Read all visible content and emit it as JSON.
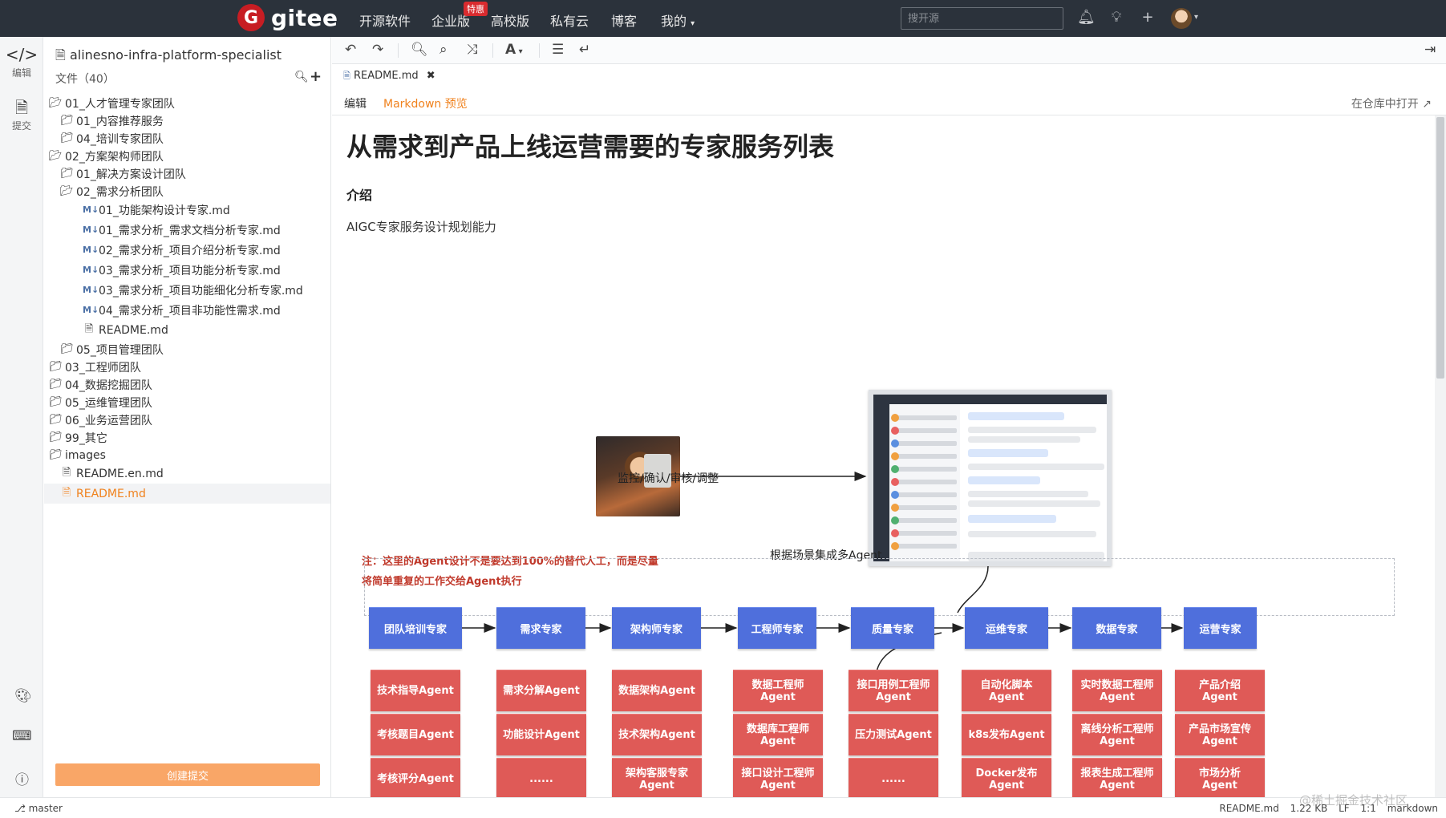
{
  "topnav": {
    "brand": "gitee",
    "links": [
      "开源软件",
      "企业版",
      "高校版",
      "私有云",
      "博客",
      "我的"
    ],
    "hot_badge": "特惠",
    "search_placeholder": "搜开源"
  },
  "activity": {
    "edit_label": "编辑",
    "commit_label": "提交"
  },
  "filetree": {
    "repo_name": "alinesno-infra-platform-specialist",
    "files_count": "文件（40）",
    "nodes": [
      {
        "label": "01_人才管理专家团队",
        "type": "folder-open",
        "depth": 0
      },
      {
        "label": "01_内容推荐服务",
        "type": "folder",
        "depth": 1
      },
      {
        "label": "04_培训专家团队",
        "type": "folder",
        "depth": 1
      },
      {
        "label": "02_方案架构师团队",
        "type": "folder-open",
        "depth": 0
      },
      {
        "label": "01_解决方案设计团队",
        "type": "folder",
        "depth": 1
      },
      {
        "label": "02_需求分析团队",
        "type": "folder-open",
        "depth": 1
      },
      {
        "label": "01_功能架构设计专家.md",
        "type": "md",
        "depth": 2
      },
      {
        "label": "01_需求分析_需求文档分析专家.md",
        "type": "md",
        "depth": 2
      },
      {
        "label": "02_需求分析_项目介绍分析专家.md",
        "type": "md",
        "depth": 2
      },
      {
        "label": "03_需求分析_项目功能分析专家.md",
        "type": "md",
        "depth": 2
      },
      {
        "label": "03_需求分析_项目功能细化分析专家.md",
        "type": "md",
        "depth": 2
      },
      {
        "label": "04_需求分析_项目非功能性需求.md",
        "type": "md",
        "depth": 2
      },
      {
        "label": "README.md",
        "type": "readme",
        "depth": 2
      },
      {
        "label": "05_项目管理团队",
        "type": "folder",
        "depth": 1
      },
      {
        "label": "03_工程师团队",
        "type": "folder",
        "depth": 0
      },
      {
        "label": "04_数据挖掘团队",
        "type": "folder",
        "depth": 0
      },
      {
        "label": "05_运维管理团队",
        "type": "folder",
        "depth": 0
      },
      {
        "label": "06_业务运营团队",
        "type": "folder",
        "depth": 0
      },
      {
        "label": "99_其它",
        "type": "folder",
        "depth": 0
      },
      {
        "label": "images",
        "type": "folder",
        "depth": 0
      },
      {
        "label": "README.en.md",
        "type": "readme",
        "depth": 0
      },
      {
        "label": "README.md",
        "type": "readme",
        "depth": 0,
        "active": true
      }
    ],
    "commit_button": "创建提交"
  },
  "editor": {
    "file_tab": "README.md",
    "mode_edit": "编辑",
    "mode_preview": "Markdown 预览",
    "open_in_repo": "在仓库中打开"
  },
  "preview": {
    "h1": "从需求到产品上线运营需要的专家服务列表",
    "h2": "介绍",
    "para": "AIGC专家服务设计规划能力",
    "diagram": {
      "arrow_label": "监控/确认/审核/调整",
      "integrate_label": "根据场景集成多Agent",
      "note_line1": "注：这里的Agent设计不是要达到100%的替代人工，而是尽量",
      "note_line2": "将简单重复的工作交给Agent执行",
      "roles": [
        "团队培训专家",
        "需求专家",
        "架构师专家",
        "工程师专家",
        "质量专家",
        "运维专家",
        "数据专家",
        "运营专家"
      ],
      "agents": [
        [
          "技术指导Agent",
          "需求分解Agent",
          "数据架构Agent",
          "数据工程师\nAgent",
          "接口用例工程师\nAgent",
          "自动化脚本\nAgent",
          "实时数据工程师\nAgent",
          "产品介绍\nAgent"
        ],
        [
          "考核题目Agent",
          "功能设计Agent",
          "技术架构Agent",
          "数据库工程师\nAgent",
          "压力测试Agent",
          "k8s发布Agent",
          "离线分析工程师\nAgent",
          "产品市场宣传\nAgent"
        ],
        [
          "考核评分Agent",
          "......",
          "架构客服专家\nAgent",
          "接口设计工程师\nAgent",
          "......",
          "Docker发布\nAgent",
          "报表生成工程师\nAgent",
          "市场分析\nAgent"
        ]
      ]
    }
  },
  "statusbar": {
    "branch": "master",
    "file": "README.md",
    "size": "1.22 KB",
    "eol": "LF",
    "position": "1:1",
    "lang": "markdown",
    "watermark": "@稀土掘金技术社区"
  },
  "colors": {
    "accent": "#f0821e",
    "role_blue": "#4f6fdc",
    "agent_red": "#df5a57",
    "nav_bg": "#2b323b"
  }
}
